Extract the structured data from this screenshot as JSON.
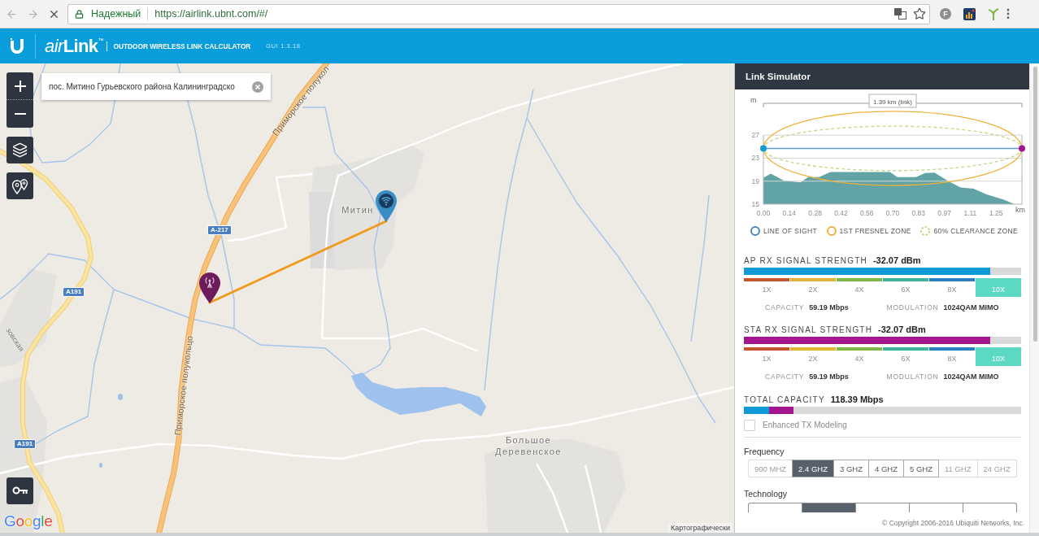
{
  "browser": {
    "security": "Надежный",
    "url": "https://airlink.ubnt.com/#/",
    "extensions": [
      {
        "kind": "letter",
        "text": "F"
      },
      {
        "kind": "chart"
      },
      {
        "kind": "sprout"
      }
    ]
  },
  "header": {
    "logo": {
      "prefix": "air",
      "name": "Link",
      "mark": "™"
    },
    "subtitle": "OUTDOOR WIRELESS LINK CALCULATOR",
    "version": "GUI 1.3.18"
  },
  "map": {
    "search": {
      "value": "пос. Митино Гурьевского района Калининградско"
    },
    "labels": [
      {
        "kind": "road",
        "text": "Приморское полукол"
      },
      {
        "kind": "road",
        "text": "Приморское полукольцо"
      },
      {
        "kind": "place",
        "text": "Митин"
      },
      {
        "kind": "street",
        "text": "зовская"
      },
      {
        "kind": "place",
        "text": "Большое Деревенское"
      }
    ],
    "road_signs": [
      "A-217",
      "A191",
      "A191"
    ],
    "attribution": "Картографически",
    "logo": "Google"
  },
  "panel": {
    "title": "Link Simulator",
    "chart_data": {
      "type": "area",
      "xlabel": "km",
      "ylabel": "m",
      "grid": true,
      "x": [
        0,
        0.04,
        0.11,
        0.2,
        0.24,
        0.3,
        0.36,
        0.68,
        0.72,
        0.82,
        0.87,
        0.92,
        1.0,
        1.06,
        1.13,
        1.2,
        1.29,
        1.35,
        1.39
      ],
      "series": [
        {
          "color": "#62a3a5",
          "values": [
            19.6,
            20.3,
            19.1,
            18.8,
            19.7,
            19.7,
            20.6,
            20.6,
            19.7,
            19.7,
            20.4,
            20.5,
            18.9,
            17.9,
            17.7,
            16.7,
            15.8,
            15,
            null
          ]
        },
        {
          "type": "line",
          "color": "#5b9bd5",
          "values": [
            24.7,
            24.7,
            24.7,
            24.7,
            24.7,
            24.7,
            24.7,
            24.7,
            24.7,
            24.7,
            24.7,
            24.7,
            24.7,
            24.7,
            24.7,
            24.7,
            24.7,
            24.7,
            24.7
          ]
        }
      ],
      "xlim": [
        0,
        1.39
      ],
      "ylim": [
        15,
        27
      ],
      "xticks": [
        {
          "value": 0,
          "label": "0.00"
        },
        {
          "value": 0.139,
          "label": "0.14"
        },
        {
          "value": 0.278,
          "label": "0.28"
        },
        {
          "value": 0.417,
          "label": "0.42"
        },
        {
          "value": 0.556,
          "label": "0.56"
        },
        {
          "value": 0.695,
          "label": "0.70"
        },
        {
          "value": 0.834,
          "label": "0.83"
        },
        {
          "value": 0.973,
          "label": "0.97"
        },
        {
          "value": 1.112,
          "label": "1.11"
        },
        {
          "value": 1.251,
          "label": "1.25"
        }
      ],
      "yticks": [
        15,
        19,
        23,
        27
      ],
      "annotations": [
        {
          "text": "1.39 km (link)"
        }
      ]
    },
    "legend": [
      {
        "label": "LINE OF SIGHT",
        "color": "#4a86bb",
        "kind": "solid"
      },
      {
        "label": "1ST FRESNEL ZONE",
        "color": "#f0b23a",
        "kind": "solid"
      },
      {
        "label": "60% CLEARANCE ZONE",
        "color": "#c4d784",
        "kind": "dashed"
      }
    ],
    "signals": [
      {
        "label": "AP RX SIGNAL STRENGTH",
        "value": "-32.07 dBm",
        "level": 0.89,
        "color": "#0e9bd8",
        "rates": [
          {
            "label": "1X",
            "color": "#c4562c",
            "selected": false
          },
          {
            "label": "2X",
            "color": "#e0b435",
            "selected": false
          },
          {
            "label": "4X",
            "color": "#80b847",
            "selected": false
          },
          {
            "label": "6X",
            "color": "#3eb39c",
            "selected": false
          },
          {
            "label": "8X",
            "color": "#2a7fc0",
            "selected": false
          },
          {
            "label": "10X",
            "color": "#5cd9c2",
            "selected": true
          }
        ],
        "capacity_label": "CAPACITY",
        "capacity": "59.19 Mbps",
        "modulation_label": "MODULATION",
        "modulation": "1024QAM MIMO"
      },
      {
        "label": "STA RX SIGNAL STRENGTH",
        "value": "-32.07 dBm",
        "level": 0.89,
        "color": "#a3168f",
        "rates": [
          {
            "label": "1X",
            "color": "#c4562c",
            "selected": false
          },
          {
            "label": "2X",
            "color": "#e0b435",
            "selected": false
          },
          {
            "label": "4X",
            "color": "#80b847",
            "selected": false
          },
          {
            "label": "6X",
            "color": "#3eb39c",
            "selected": false
          },
          {
            "label": "8X",
            "color": "#2a7fc0",
            "selected": false
          },
          {
            "label": "10X",
            "color": "#5cd9c2",
            "selected": true
          }
        ],
        "capacity_label": "CAPACITY",
        "capacity": "59.19 Mbps",
        "modulation_label": "MODULATION",
        "modulation": "1024QAM MIMO"
      }
    ],
    "total": {
      "label": "TOTAL CAPACITY",
      "value": "118.39 Mbps",
      "segments": [
        {
          "level": 0.09,
          "color": "#0e9bd8"
        },
        {
          "level": 0.09,
          "color": "#a3168f"
        }
      ]
    },
    "enhanced_tx": {
      "label": "Enhanced TX Modeling",
      "checked": false
    },
    "frequency": {
      "label": "Frequency",
      "options": [
        {
          "label": "900 MHZ",
          "selected": false,
          "disabled": true
        },
        {
          "label": "2.4 GHZ",
          "selected": true,
          "disabled": false
        },
        {
          "label": "3 GHZ",
          "selected": false,
          "disabled": false
        },
        {
          "label": "4 GHZ",
          "selected": false,
          "disabled": false
        },
        {
          "label": "5 GHZ",
          "selected": false,
          "disabled": false
        },
        {
          "label": "11 GHZ",
          "selected": false,
          "disabled": true
        },
        {
          "label": "24 GHZ",
          "selected": false,
          "disabled": true
        }
      ]
    },
    "technology": {
      "label": "Technology",
      "options": [
        {
          "selected": false
        },
        {
          "selected": true
        },
        {
          "selected": false
        },
        {
          "selected": false
        },
        {
          "selected": false
        }
      ]
    },
    "copyright": "© Copyright 2006-2016 Ubiquiti Networks, Inc."
  }
}
